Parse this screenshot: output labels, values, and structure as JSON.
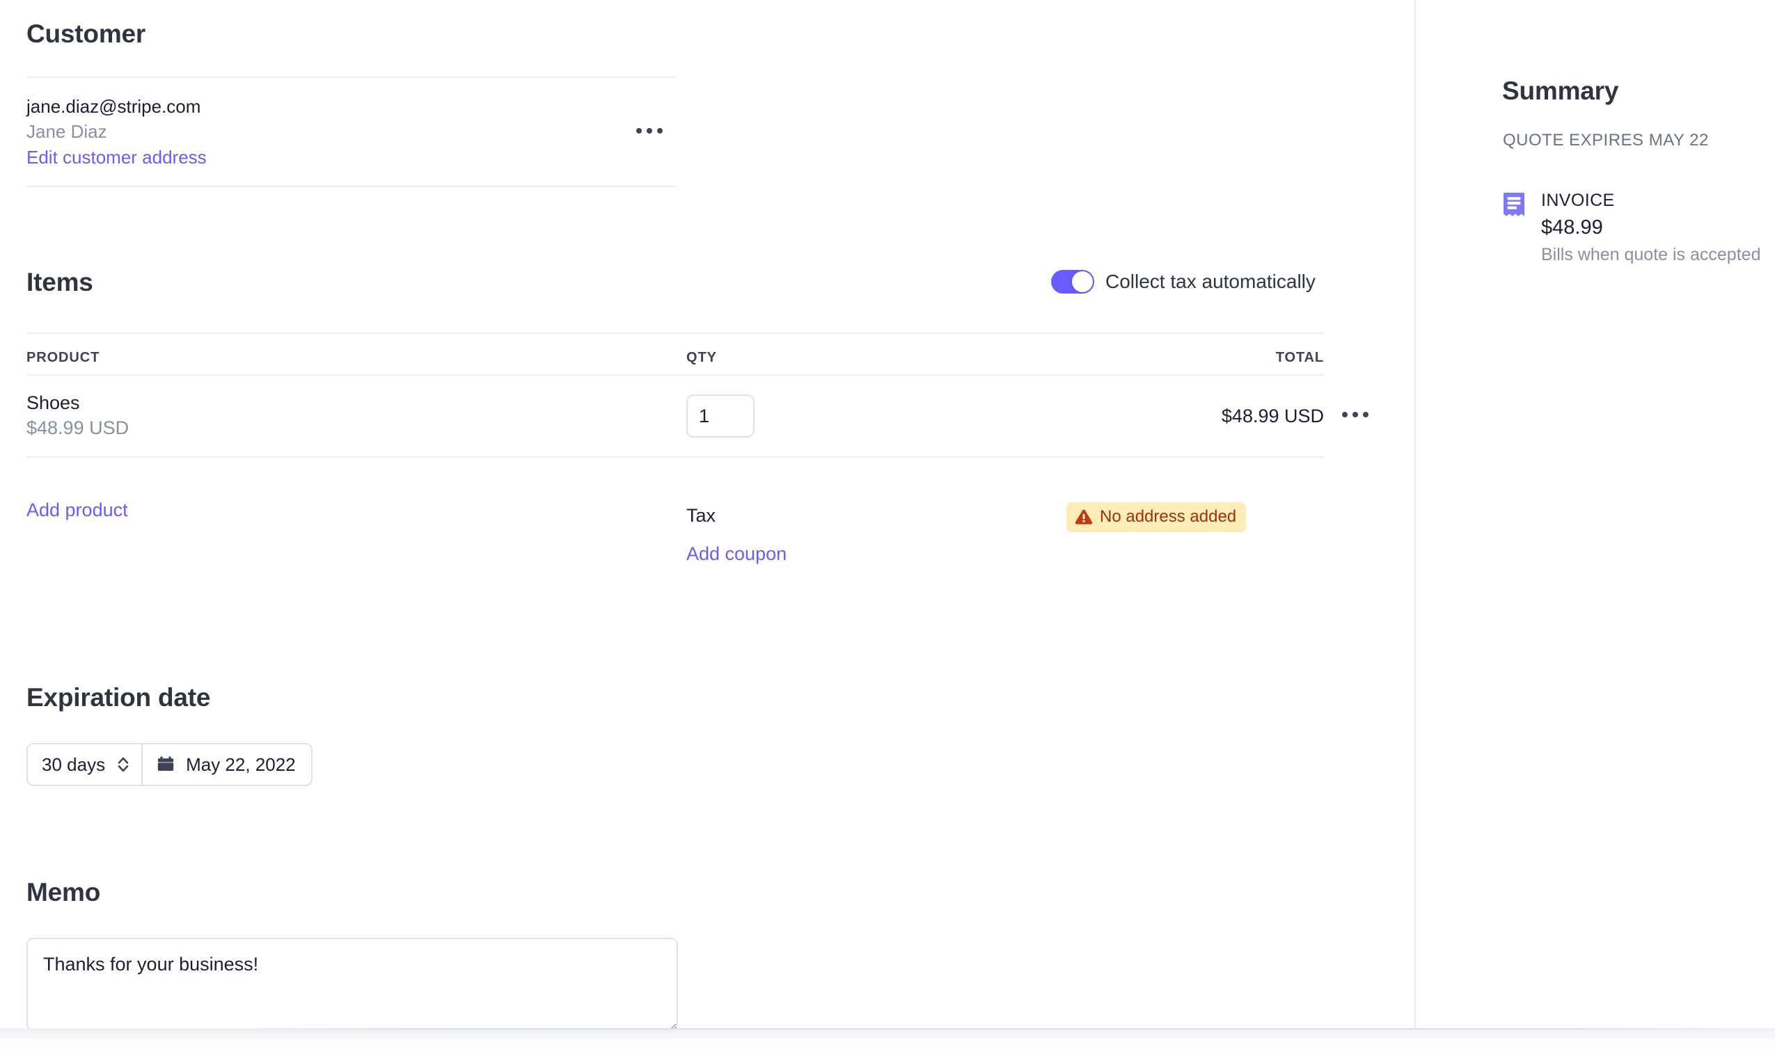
{
  "customer": {
    "heading": "Customer",
    "email": "jane.diaz@stripe.com",
    "name": "Jane Diaz",
    "edit_address_link": "Edit customer address",
    "menu_icon": "ellipsis-icon"
  },
  "items": {
    "heading": "Items",
    "tax_toggle": {
      "label": "Collect tax automatically",
      "enabled": true,
      "accent_color": "#675dff"
    },
    "columns": [
      "PRODUCT",
      "QTY",
      "TOTAL"
    ],
    "rows": [
      {
        "product": "Shoes",
        "unit_price": "$48.99 USD",
        "qty": "1",
        "total": "$48.99 USD",
        "menu_icon": "ellipsis-icon"
      }
    ],
    "add_product_link": "Add product",
    "tax_label": "Tax",
    "tax_status_badge": {
      "text": "No address added",
      "icon": "warning-triangle-icon",
      "background": "#fcedb9",
      "text_color": "#a82e08"
    },
    "add_coupon_link": "Add coupon"
  },
  "expiration": {
    "heading": "Expiration date",
    "duration_value": "30 days",
    "duration_icon": "chevron-up-down-icon",
    "date_icon": "calendar-icon",
    "date_value": "May 22, 2022"
  },
  "memo": {
    "heading": "Memo",
    "value": "Thanks for your business!",
    "placeholder": "Thanks for your business!"
  },
  "summary": {
    "heading": "Summary",
    "expiry_note": "QUOTE EXPIRES MAY 22",
    "invoice": {
      "icon": "invoice-receipt-icon",
      "label": "INVOICE",
      "amount": "$48.99",
      "note": "Bills when quote is accepted"
    }
  }
}
